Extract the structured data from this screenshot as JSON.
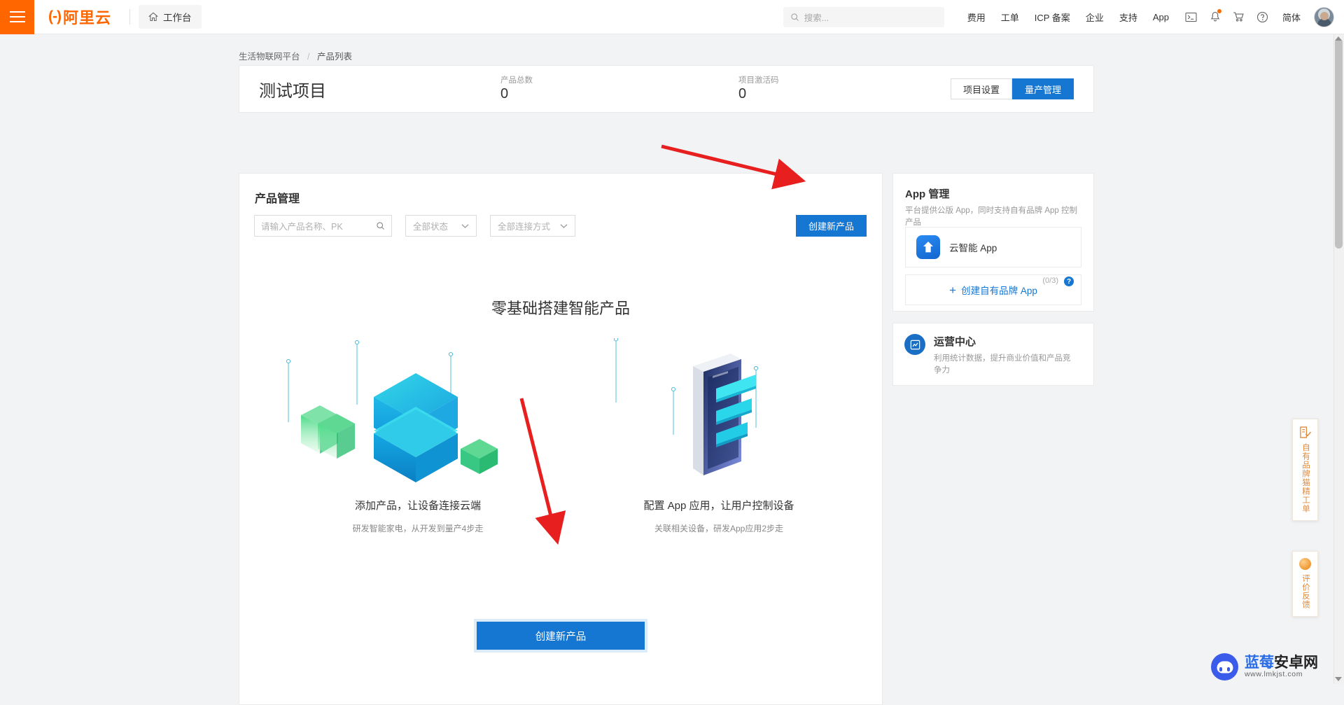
{
  "topbar": {
    "menu_icon": "hamburger-icon",
    "logo_text": "阿里云",
    "workbench_label": "工作台",
    "home_icon": "home-icon",
    "search": {
      "placeholder": "搜索...",
      "icon": "search-icon"
    },
    "nav_links": [
      "费用",
      "工单",
      "ICP 备案",
      "企业",
      "支持",
      "App"
    ],
    "icons": [
      "terminal-icon",
      "bell-icon",
      "cart-icon",
      "help-circle-icon"
    ],
    "language": "简体",
    "avatar": "user-avatar"
  },
  "breadcrumb": {
    "parent": "生活物联网平台",
    "separator": "/",
    "current": "产品列表"
  },
  "project": {
    "title": "测试项目",
    "stats": [
      {
        "label": "产品总数",
        "value": "0"
      },
      {
        "label": "项目激活码",
        "value": "0"
      }
    ],
    "settings_button": "项目设置",
    "massproduction_button": "量产管理"
  },
  "product_section": {
    "title": "产品管理",
    "search": {
      "placeholder": "请输入产品名称、PK",
      "icon": "search-icon"
    },
    "status_filter": {
      "value": "全部状态",
      "icon": "chevron-down-icon"
    },
    "connection_filter": {
      "value": "全部连接方式",
      "icon": "chevron-down-icon"
    },
    "create_button": "创建新产品"
  },
  "empty_state": {
    "title": "零基础搭建智能产品",
    "features": [
      {
        "caption": "添加产品，让设备连接云端",
        "sub": "研发智能家电，从开发到量产4步走",
        "illustration": "isometric-cube-illustration"
      },
      {
        "caption": "配置 App 应用，让用户控制设备",
        "sub": "关联相关设备，研发App应用2步走",
        "illustration": "isometric-phone-illustration"
      }
    ],
    "primary_button": "创建新产品"
  },
  "app_panel": {
    "title": "App 管理",
    "description": "平台提供公版 App，同时支持自有品牌 App 控制产品",
    "app_item": {
      "name": "云智能 App",
      "icon": "cloud-app-icon"
    },
    "brand_button": {
      "label": "创建自有品牌 App",
      "plus": "+",
      "count": "(0/3)",
      "help": "?"
    }
  },
  "ops_panel": {
    "title": "运营中心",
    "description": "利用统计数据，提升商业价值和产品竞争力",
    "icon": "chart-circle-icon"
  },
  "float_tabs": [
    {
      "label": "自有品牌猫精工单",
      "icon": "form-check-icon"
    },
    {
      "label": "评价反馈",
      "icon": "orange-ball-icon"
    }
  ],
  "watermark": {
    "name_blue": "蓝莓",
    "name_dark": "安卓网",
    "url": "www.lmkjst.com"
  },
  "colors": {
    "brand_orange": "#ff6600",
    "primary_blue": "#1677d2",
    "annotation_red": "#e81f1f"
  }
}
